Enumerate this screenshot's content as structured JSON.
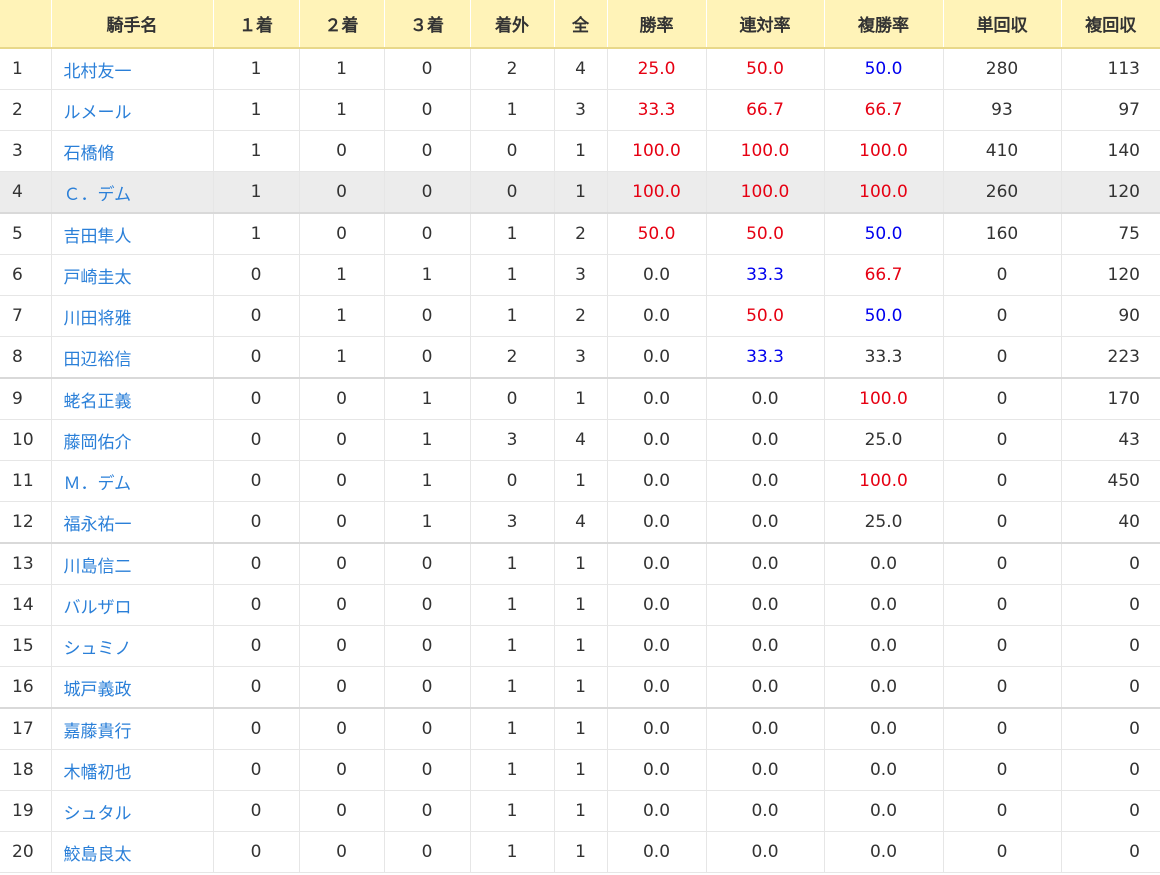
{
  "table": {
    "headers": {
      "rank": "",
      "name": "騎手名",
      "first": "１着",
      "second": "２着",
      "third": "３着",
      "out": "着外",
      "all": "全",
      "win_rate": "勝率",
      "quinella_rate": "連対率",
      "place_rate": "複勝率",
      "win_return": "単回収",
      "place_return": "複回収"
    },
    "colors": {
      "high": "#e60012",
      "mid": "#0000ee",
      "link": "#2a7fd8"
    },
    "rows": [
      {
        "rank": "1",
        "name": "北村友一",
        "first": "1",
        "second": "1",
        "third": "0",
        "out": "2",
        "all": "4",
        "win_rate": "25.0",
        "quinella_rate": "50.0",
        "place_rate": "50.0",
        "win_return": "280",
        "place_return": "113",
        "wc": "red",
        "qc": "red",
        "pc": "blue"
      },
      {
        "rank": "2",
        "name": "ルメール",
        "first": "1",
        "second": "1",
        "third": "0",
        "out": "1",
        "all": "3",
        "win_rate": "33.3",
        "quinella_rate": "66.7",
        "place_rate": "66.7",
        "win_return": "93",
        "place_return": "97",
        "wc": "red",
        "qc": "red",
        "pc": "red"
      },
      {
        "rank": "3",
        "name": "石橋脩",
        "first": "1",
        "second": "0",
        "third": "0",
        "out": "0",
        "all": "1",
        "win_rate": "100.0",
        "quinella_rate": "100.0",
        "place_rate": "100.0",
        "win_return": "410",
        "place_return": "140",
        "wc": "red",
        "qc": "red",
        "pc": "red"
      },
      {
        "rank": "4",
        "name": "Ｃ．デム",
        "first": "1",
        "second": "0",
        "third": "0",
        "out": "0",
        "all": "1",
        "win_rate": "100.0",
        "quinella_rate": "100.0",
        "place_rate": "100.0",
        "win_return": "260",
        "place_return": "120",
        "wc": "red",
        "qc": "red",
        "pc": "red",
        "highlight": true
      },
      {
        "rank": "5",
        "name": "吉田隼人",
        "first": "1",
        "second": "0",
        "third": "0",
        "out": "1",
        "all": "2",
        "win_rate": "50.0",
        "quinella_rate": "50.0",
        "place_rate": "50.0",
        "win_return": "160",
        "place_return": "75",
        "wc": "red",
        "qc": "red",
        "pc": "blue"
      },
      {
        "rank": "6",
        "name": "戸崎圭太",
        "first": "0",
        "second": "1",
        "third": "1",
        "out": "1",
        "all": "3",
        "win_rate": "0.0",
        "quinella_rate": "33.3",
        "place_rate": "66.7",
        "win_return": "0",
        "place_return": "120",
        "wc": "",
        "qc": "blue",
        "pc": "red"
      },
      {
        "rank": "7",
        "name": "川田将雅",
        "first": "0",
        "second": "1",
        "third": "0",
        "out": "1",
        "all": "2",
        "win_rate": "0.0",
        "quinella_rate": "50.0",
        "place_rate": "50.0",
        "win_return": "0",
        "place_return": "90",
        "wc": "",
        "qc": "red",
        "pc": "blue"
      },
      {
        "rank": "8",
        "name": "田辺裕信",
        "first": "0",
        "second": "1",
        "third": "0",
        "out": "2",
        "all": "3",
        "win_rate": "0.0",
        "quinella_rate": "33.3",
        "place_rate": "33.3",
        "win_return": "0",
        "place_return": "223",
        "wc": "",
        "qc": "blue",
        "pc": ""
      },
      {
        "rank": "9",
        "name": "蛯名正義",
        "first": "0",
        "second": "0",
        "third": "1",
        "out": "0",
        "all": "1",
        "win_rate": "0.0",
        "quinella_rate": "0.0",
        "place_rate": "100.0",
        "win_return": "0",
        "place_return": "170",
        "wc": "",
        "qc": "",
        "pc": "red"
      },
      {
        "rank": "10",
        "name": "藤岡佑介",
        "first": "0",
        "second": "0",
        "third": "1",
        "out": "3",
        "all": "4",
        "win_rate": "0.0",
        "quinella_rate": "0.0",
        "place_rate": "25.0",
        "win_return": "0",
        "place_return": "43",
        "wc": "",
        "qc": "",
        "pc": ""
      },
      {
        "rank": "11",
        "name": "Ｍ．デム",
        "first": "0",
        "second": "0",
        "third": "1",
        "out": "0",
        "all": "1",
        "win_rate": "0.0",
        "quinella_rate": "0.0",
        "place_rate": "100.0",
        "win_return": "0",
        "place_return": "450",
        "wc": "",
        "qc": "",
        "pc": "red"
      },
      {
        "rank": "12",
        "name": "福永祐一",
        "first": "0",
        "second": "0",
        "third": "1",
        "out": "3",
        "all": "4",
        "win_rate": "0.0",
        "quinella_rate": "0.0",
        "place_rate": "25.0",
        "win_return": "0",
        "place_return": "40",
        "wc": "",
        "qc": "",
        "pc": ""
      },
      {
        "rank": "13",
        "name": "川島信二",
        "first": "0",
        "second": "0",
        "third": "0",
        "out": "1",
        "all": "1",
        "win_rate": "0.0",
        "quinella_rate": "0.0",
        "place_rate": "0.0",
        "win_return": "0",
        "place_return": "0",
        "wc": "",
        "qc": "",
        "pc": ""
      },
      {
        "rank": "14",
        "name": "バルザロ",
        "first": "0",
        "second": "0",
        "third": "0",
        "out": "1",
        "all": "1",
        "win_rate": "0.0",
        "quinella_rate": "0.0",
        "place_rate": "0.0",
        "win_return": "0",
        "place_return": "0",
        "wc": "",
        "qc": "",
        "pc": ""
      },
      {
        "rank": "15",
        "name": "シュミノ",
        "first": "0",
        "second": "0",
        "third": "0",
        "out": "1",
        "all": "1",
        "win_rate": "0.0",
        "quinella_rate": "0.0",
        "place_rate": "0.0",
        "win_return": "0",
        "place_return": "0",
        "wc": "",
        "qc": "",
        "pc": ""
      },
      {
        "rank": "16",
        "name": "城戸義政",
        "first": "0",
        "second": "0",
        "third": "0",
        "out": "1",
        "all": "1",
        "win_rate": "0.0",
        "quinella_rate": "0.0",
        "place_rate": "0.0",
        "win_return": "0",
        "place_return": "0",
        "wc": "",
        "qc": "",
        "pc": ""
      },
      {
        "rank": "17",
        "name": "嘉藤貴行",
        "first": "0",
        "second": "0",
        "third": "0",
        "out": "1",
        "all": "1",
        "win_rate": "0.0",
        "quinella_rate": "0.0",
        "place_rate": "0.0",
        "win_return": "0",
        "place_return": "0",
        "wc": "",
        "qc": "",
        "pc": ""
      },
      {
        "rank": "18",
        "name": "木幡初也",
        "first": "0",
        "second": "0",
        "third": "0",
        "out": "1",
        "all": "1",
        "win_rate": "0.0",
        "quinella_rate": "0.0",
        "place_rate": "0.0",
        "win_return": "0",
        "place_return": "0",
        "wc": "",
        "qc": "",
        "pc": ""
      },
      {
        "rank": "19",
        "name": "シュタル",
        "first": "0",
        "second": "0",
        "third": "0",
        "out": "1",
        "all": "1",
        "win_rate": "0.0",
        "quinella_rate": "0.0",
        "place_rate": "0.0",
        "win_return": "0",
        "place_return": "0",
        "wc": "",
        "qc": "",
        "pc": ""
      },
      {
        "rank": "20",
        "name": "鮫島良太",
        "first": "0",
        "second": "0",
        "third": "0",
        "out": "1",
        "all": "1",
        "win_rate": "0.0",
        "quinella_rate": "0.0",
        "place_rate": "0.0",
        "win_return": "0",
        "place_return": "0",
        "wc": "",
        "qc": "",
        "pc": ""
      }
    ]
  }
}
